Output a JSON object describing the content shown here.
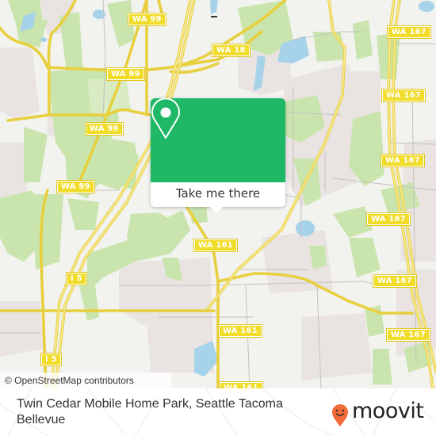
{
  "map": {
    "colors": {
      "background": "#f2f2ef",
      "park": "#c9e5ad",
      "residential": "#e9e3e2",
      "water": "#a6d2ea",
      "road_major": "#f4df5e",
      "road_minor": "#c4c1bd",
      "shield_fill": "#f1dc2a"
    },
    "road_labels": [
      {
        "id": "wa99-1",
        "text": "WA 99"
      },
      {
        "id": "wa99-2",
        "text": "WA 99"
      },
      {
        "id": "wa99-3",
        "text": "WA 99"
      },
      {
        "id": "wa99-4",
        "text": "WA 99"
      },
      {
        "id": "wa18",
        "text": "WA 18"
      },
      {
        "id": "wa167-1",
        "text": "WA 167"
      },
      {
        "id": "wa167-2",
        "text": "WA 167"
      },
      {
        "id": "wa167-3",
        "text": "WA 167"
      },
      {
        "id": "wa167-4",
        "text": "WA 167"
      },
      {
        "id": "wa167-5",
        "text": "WA 167"
      },
      {
        "id": "wa167-6",
        "text": "WA 167"
      },
      {
        "id": "wa167-7",
        "text": "WA 167"
      },
      {
        "id": "wa161-1",
        "text": "WA 161"
      },
      {
        "id": "wa161-2",
        "text": "WA 161"
      },
      {
        "id": "wa161-3",
        "text": "WA 161"
      },
      {
        "id": "i5-1",
        "text": "I 5"
      },
      {
        "id": "i5-2",
        "text": "I 5"
      }
    ],
    "attribution": "© OpenStreetMap contributors"
  },
  "popup": {
    "accent": "#1eb866",
    "icon": "location-pin-icon",
    "button_label": "Take me there"
  },
  "footer": {
    "place_title": "Twin Cedar Mobile Home Park, Seattle Tacoma Bellevue",
    "brand": {
      "name": "moovit",
      "logo_icon": "moovit-smiley-pin-icon",
      "logo_color": "#f26a37"
    }
  }
}
